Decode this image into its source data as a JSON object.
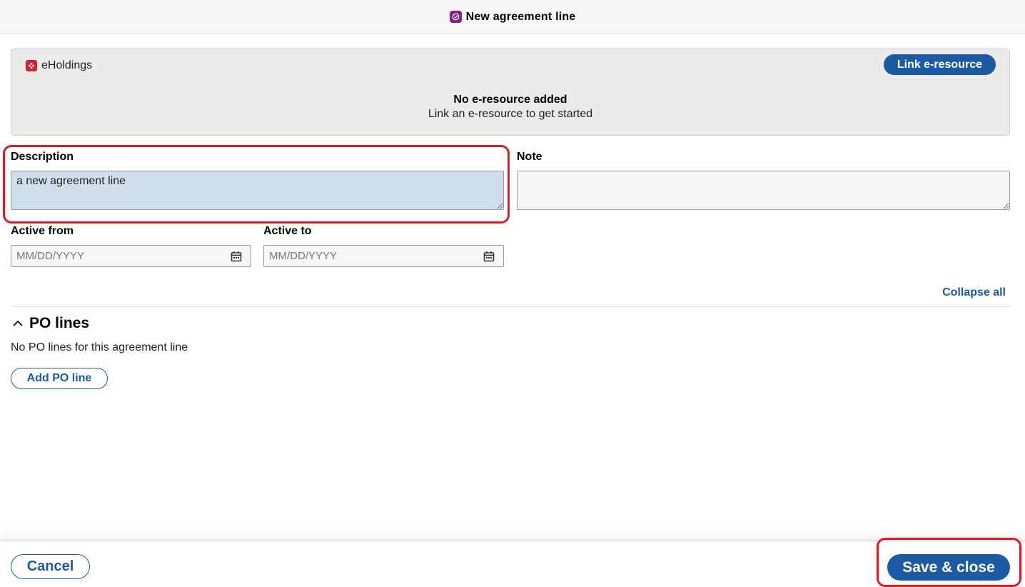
{
  "header": {
    "title": "New agreement line",
    "icon": "agreements-app-icon"
  },
  "eholdings": {
    "label": "eHoldings",
    "link_button": "Link e-resource",
    "empty_title": "No e-resource added",
    "empty_subtitle": "Link an e-resource to get started"
  },
  "form": {
    "description_label": "Description",
    "description_value": "a new agreement line",
    "note_label": "Note",
    "note_value": "",
    "active_from_label": "Active from",
    "active_from_placeholder": "MM/DD/YYYY",
    "active_to_label": "Active to",
    "active_to_placeholder": "MM/DD/YYYY"
  },
  "collapse_all": "Collapse all",
  "po_lines": {
    "title": "PO lines",
    "empty": "No PO lines for this agreement line",
    "add_button": "Add PO line"
  },
  "footer": {
    "cancel": "Cancel",
    "save": "Save & close"
  },
  "colors": {
    "accent": "#1c5aa3",
    "highlight": "#e01b24",
    "app_icon": "#8a1f8a",
    "eholdings_icon": "#c8262e"
  }
}
